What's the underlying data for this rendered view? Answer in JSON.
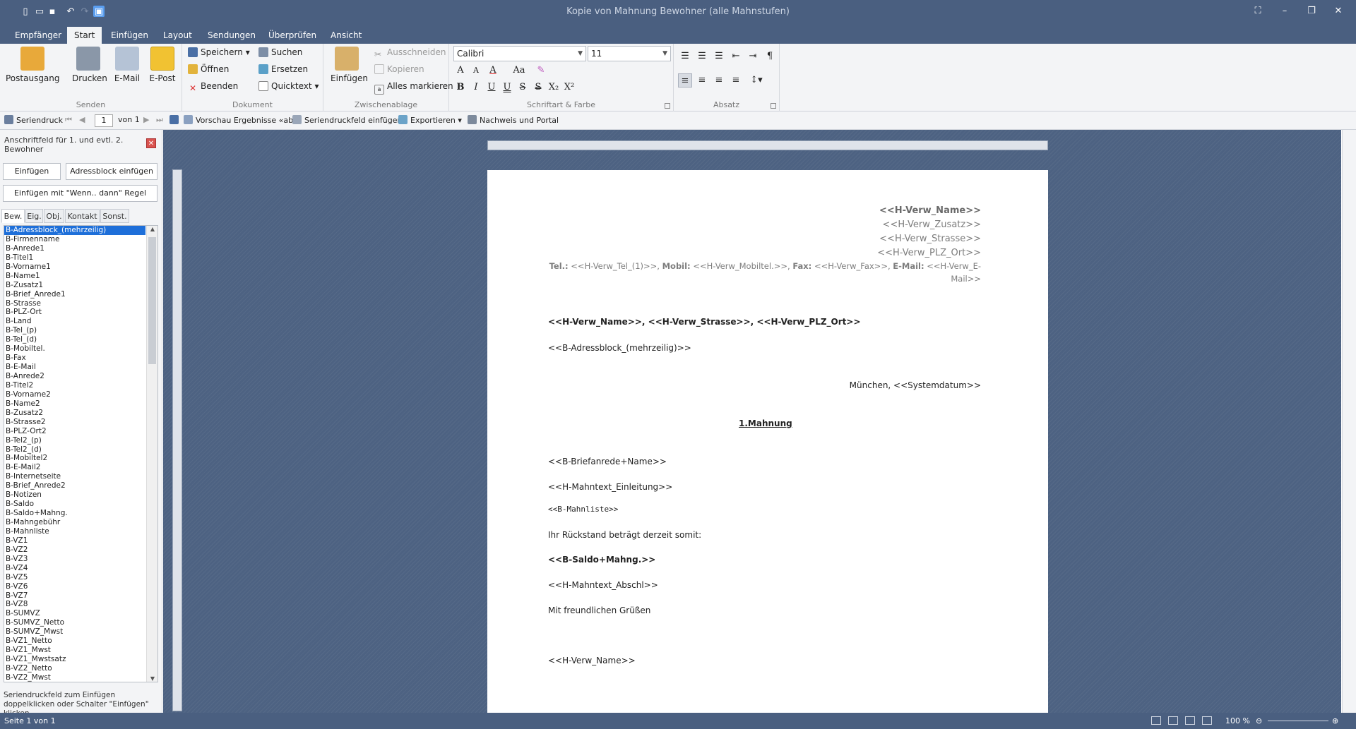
{
  "window": {
    "title": "Kopie von Mahnung Bewohner (alle Mahnstufen)"
  },
  "tabs": [
    "Empfänger",
    "Start",
    "Einfügen",
    "Layout",
    "Sendungen",
    "Überprüfen",
    "Ansicht"
  ],
  "ribbon": {
    "senden": {
      "label": "Senden",
      "postausgang": "Postausgang",
      "drucken": "Drucken",
      "email": "E-Mail",
      "epost": "E-Post"
    },
    "dokument": {
      "label": "Dokument",
      "speichern": "Speichern",
      "oeffnen": "Öffnen",
      "beenden": "Beenden",
      "suchen": "Suchen",
      "ersetzen": "Ersetzen",
      "quicktext": "Quicktext"
    },
    "zwischenablage": {
      "label": "Zwischenablage",
      "einfuegen": "Einfügen",
      "ausschneiden": "Ausschneiden",
      "kopieren": "Kopieren",
      "alles_markieren": "Alles markieren"
    },
    "schrift": {
      "label": "Schriftart & Farbe",
      "font": "Calibri",
      "size": "11"
    },
    "absatz": {
      "label": "Absatz"
    }
  },
  "mergebar": {
    "seriendruck": "Seriendruck",
    "page": "1",
    "of": "von 1",
    "vorschau": "Vorschau Ergebnisse «abc»",
    "feld_einfuegen": "Seriendruckfeld einfügen",
    "exportieren": "Exportieren",
    "nachweis": "Nachweis und Portal"
  },
  "leftpane": {
    "header": "Anschriftfeld für 1. und evtl. 2. Bewohner",
    "btn_einfuegen": "Einfügen",
    "btn_adressblock": "Adressblock einfügen",
    "btn_wenn": "Einfügen mit \"Wenn.. dann\" Regel",
    "tabs": [
      "Bew.",
      "Eig.",
      "Obj.",
      "Kontakt",
      "Sonst."
    ],
    "items": [
      "B-Adressblock_(mehrzeilig)",
      "B-Firmenname",
      "B-Anrede1",
      "B-Titel1",
      "B-Vorname1",
      "B-Name1",
      "B-Zusatz1",
      "B-Brief_Anrede1",
      "B-Strasse",
      "B-PLZ-Ort",
      "B-Land",
      "B-Tel_(p)",
      "B-Tel_(d)",
      "B-Mobiltel.",
      "B-Fax",
      "B-E-Mail",
      "B-Anrede2",
      "B-Titel2",
      "B-Vorname2",
      "B-Name2",
      "B-Zusatz2",
      "B-Strasse2",
      "B-PLZ-Ort2",
      "B-Tel2_(p)",
      "B-Tel2_(d)",
      "B-Mobiltel2",
      "B-E-Mail2",
      "B-Internetseite",
      "B-Brief_Anrede2",
      "B-Notizen",
      "B-Saldo",
      "B-Saldo+Mahng.",
      "B-Mahngebühr",
      "B-Mahnliste",
      "B-VZ1",
      "B-VZ2",
      "B-VZ3",
      "B-VZ4",
      "B-VZ5",
      "B-VZ6",
      "B-VZ7",
      "B-VZ8",
      "B-SUMVZ",
      "B-SUMVZ_Netto",
      "B-SUMVZ_Mwst",
      "B-VZ1_Netto",
      "B-VZ1_Mwst",
      "B-VZ1_Mwstsatz",
      "B-VZ2_Netto",
      "B-VZ2_Mwst"
    ],
    "hint": "Seriendruckfeld zum Einfügen doppelklicken oder Schalter \"Einfügen\" klicken."
  },
  "document": {
    "h_name": "<<H-Verw_Name>>",
    "h_zusatz": "<<H-Verw_Zusatz>>",
    "h_strasse": "<<H-Verw_Strasse>>",
    "h_plz": "<<H-Verw_PLZ_Ort>>",
    "tel_label": "Tel.:",
    "tel_val": "<<H-Verw_Tel_(1)>>,",
    "mobil_label": "Mobil:",
    "mobil_val": "<<H-Verw_Mobiltel.>>,",
    "fax_label": "Fax:",
    "fax_val": "<<H-Verw_Fax>>,",
    "email_label": "E-Mail:",
    "email_val": "<<H-Verw_E-",
    "email_val2": "Mail>>",
    "sender_line": "<<H-Verw_Name>>,  <<H-Verw_Strasse>>, <<H-Verw_PLZ_Ort>>",
    "adressblock": "<<B-Adressblock_(mehrzeilig)>>",
    "datum": "München, <<Systemdatum>>",
    "betreff": "1.Mahnung",
    "anrede": "<<B-Briefanrede+Name>>",
    "einleitung": "<<H-Mahntext_Einleitung>>",
    "mahnliste": "<<B-Mahnliste>>",
    "rueckstand": "Ihr Rückstand beträgt derzeit somit:",
    "saldo": "<<B-Saldo+Mahng.>>",
    "abschluss": "<<H-Mahntext_Abschl>>",
    "gruss": "Mit freundlichen Grüßen",
    "signatur": "<<H-Verw_Name>>"
  },
  "status": {
    "page": "Seite 1 von 1",
    "zoom": "100 %"
  },
  "colors": {
    "titlebar": "#4a5f80",
    "ribbon": "#f3f4f6",
    "selection": "#1e6fd9"
  }
}
